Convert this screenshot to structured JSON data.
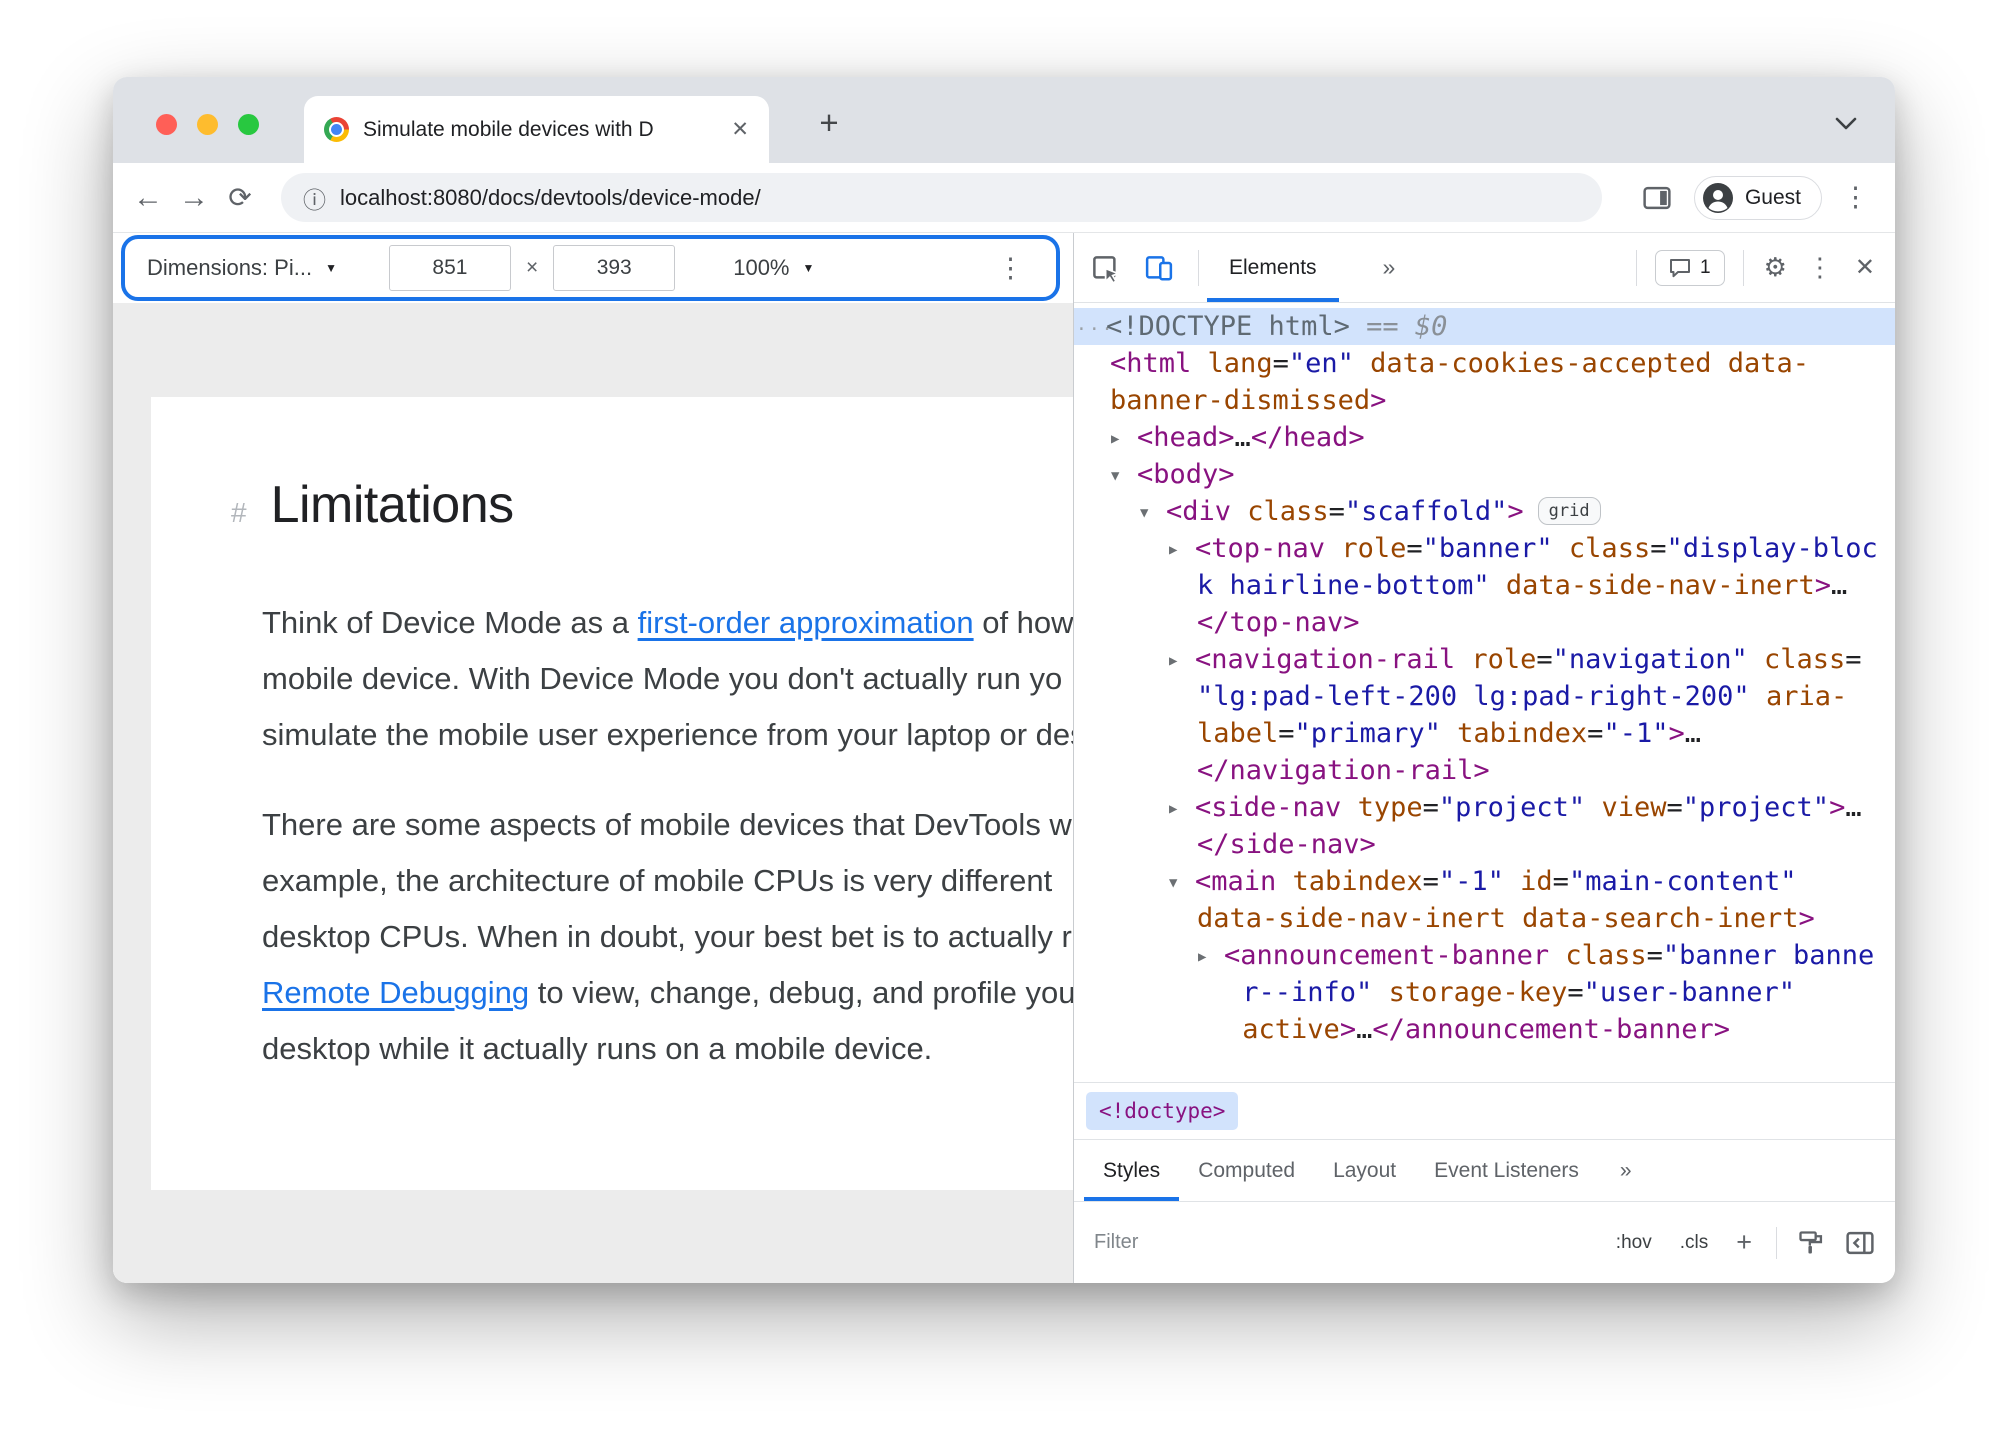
{
  "colors": {
    "accent_blue": "#1a73e8",
    "selection_blue": "#d2e3fc",
    "tag_color": "#881280",
    "attr_name_color": "#994500",
    "attr_value_color": "#1a1aa6",
    "traffic_red": "#ff5f57",
    "traffic_yellow": "#febc2e",
    "traffic_green": "#28c840"
  },
  "icons": {
    "back": "←",
    "forward": "→",
    "reload": "⟳",
    "info": "ⓘ",
    "close": "✕",
    "plus": "+",
    "kebab": "⋮",
    "caret_down": "▼",
    "multiply": "×",
    "gear": "⚙",
    "twisty_open": "▼",
    "twisty_closed": "▶",
    "dots": "···"
  },
  "browser": {
    "tab_title": "Simulate mobile devices with D",
    "url": "localhost:8080/docs/devtools/device-mode/",
    "profile_label": "Guest"
  },
  "device_toolbar": {
    "dimensions_label": "Dimensions: Pi...",
    "width": "851",
    "height": "393",
    "zoom": "100%"
  },
  "page": {
    "heading_hash": "#",
    "heading": "Limitations",
    "paragraphs": [
      {
        "lines": [
          [
            {
              "t": "Think of Device Mode as a "
            },
            {
              "t": "first-order approximation",
              "link": true
            },
            {
              "t": " of how yo"
            }
          ],
          [
            {
              "t": "mobile device. With Device Mode you don't actually run yo"
            }
          ],
          [
            {
              "t": "simulate the mobile user experience from your laptop or des"
            }
          ]
        ]
      },
      {
        "lines": [
          [
            {
              "t": "There are some aspects of mobile devices that DevTools w"
            }
          ],
          [
            {
              "t": "example, the architecture of mobile CPUs is very different"
            }
          ],
          [
            {
              "t": "desktop CPUs. When in doubt, your best bet is to actually r"
            }
          ],
          [
            {
              "t": "Remote Debugging",
              "link": true
            },
            {
              "t": " to view, change, debug, and profile your"
            }
          ],
          [
            {
              "t": "desktop while it actually runs on a mobile device."
            }
          ]
        ]
      }
    ]
  },
  "devtools": {
    "panel_tab": "Elements",
    "more": "»",
    "issues_count": "1",
    "breadcrumb": "<!doctype>",
    "styles_tabs": [
      "Styles",
      "Computed",
      "Layout",
      "Event Listeners",
      "»"
    ],
    "filter_placeholder": "Filter",
    "pseudo": ":hov",
    "classes": ".cls",
    "plus": "+",
    "tree": [
      {
        "ind": 0,
        "sel": true,
        "tok": [
          [
            "g",
            "···"
          ],
          [
            "d",
            "<!DOCTYPE html>"
          ],
          [
            "i",
            " == $0"
          ]
        ]
      },
      {
        "ind": 0,
        "tok": [
          [
            "p",
            "<html"
          ],
          [
            "t",
            " "
          ],
          [
            "a",
            "lang"
          ],
          [
            "t",
            "="
          ],
          [
            "v",
            "\"en\""
          ],
          [
            "t",
            " "
          ],
          [
            "a",
            "data-cookies-accepted"
          ],
          [
            "t",
            " "
          ],
          [
            "a",
            "data-"
          ]
        ]
      },
      {
        "ind": 0,
        "tok": [
          [
            "a",
            "banner-dismissed"
          ],
          [
            "p",
            ">"
          ]
        ]
      },
      {
        "ind": 1,
        "arrow": "closed",
        "tok": [
          [
            "p",
            "<head>"
          ],
          [
            "t",
            "…"
          ],
          [
            "p",
            "</head>"
          ]
        ]
      },
      {
        "ind": 1,
        "arrow": "open",
        "tok": [
          [
            "p",
            "<body>"
          ]
        ]
      },
      {
        "ind": 2,
        "arrow": "open",
        "tok": [
          [
            "p",
            "<div"
          ],
          [
            "t",
            " "
          ],
          [
            "a",
            "class"
          ],
          [
            "t",
            "="
          ],
          [
            "v",
            "\"scaffold\""
          ],
          [
            "p",
            ">"
          ],
          [
            "b",
            "grid"
          ]
        ]
      },
      {
        "ind": 3,
        "arrow": "closed",
        "tok": [
          [
            "p",
            "<top-nav"
          ],
          [
            "t",
            " "
          ],
          [
            "a",
            "role"
          ],
          [
            "t",
            "="
          ],
          [
            "v",
            "\"banner\""
          ],
          [
            "t",
            " "
          ],
          [
            "a",
            "class"
          ],
          [
            "t",
            "="
          ],
          [
            "v",
            "\"display-bloc"
          ]
        ]
      },
      {
        "ind": 3,
        "tok": [
          [
            "v",
            "k hairline-bottom\""
          ],
          [
            "t",
            " "
          ],
          [
            "a",
            "data-side-nav-inert"
          ],
          [
            "p",
            ">"
          ],
          [
            "t",
            "…"
          ]
        ]
      },
      {
        "ind": 3,
        "tok": [
          [
            "p",
            "</top-nav>"
          ]
        ]
      },
      {
        "ind": 3,
        "arrow": "closed",
        "tok": [
          [
            "p",
            "<navigation-rail"
          ],
          [
            "t",
            " "
          ],
          [
            "a",
            "role"
          ],
          [
            "t",
            "="
          ],
          [
            "v",
            "\"navigation\""
          ],
          [
            "t",
            " "
          ],
          [
            "a",
            "class"
          ],
          [
            "t",
            "="
          ]
        ]
      },
      {
        "ind": 3,
        "tok": [
          [
            "v",
            "\"lg:pad-left-200 lg:pad-right-200\""
          ],
          [
            "t",
            " "
          ],
          [
            "a",
            "aria-"
          ]
        ]
      },
      {
        "ind": 3,
        "tok": [
          [
            "a",
            "label"
          ],
          [
            "t",
            "="
          ],
          [
            "v",
            "\"primary\""
          ],
          [
            "t",
            " "
          ],
          [
            "a",
            "tabindex"
          ],
          [
            "t",
            "="
          ],
          [
            "v",
            "\"-1\""
          ],
          [
            "p",
            ">"
          ],
          [
            "t",
            "…"
          ]
        ]
      },
      {
        "ind": 3,
        "tok": [
          [
            "p",
            "</navigation-rail>"
          ]
        ]
      },
      {
        "ind": 3,
        "arrow": "closed",
        "tok": [
          [
            "p",
            "<side-nav"
          ],
          [
            "t",
            " "
          ],
          [
            "a",
            "type"
          ],
          [
            "t",
            "="
          ],
          [
            "v",
            "\"project\""
          ],
          [
            "t",
            " "
          ],
          [
            "a",
            "view"
          ],
          [
            "t",
            "="
          ],
          [
            "v",
            "\"project\""
          ],
          [
            "p",
            ">"
          ],
          [
            "t",
            "…"
          ]
        ]
      },
      {
        "ind": 3,
        "tok": [
          [
            "p",
            "</side-nav>"
          ]
        ]
      },
      {
        "ind": 3,
        "arrow": "open",
        "tok": [
          [
            "p",
            "<main"
          ],
          [
            "t",
            " "
          ],
          [
            "a",
            "tabindex"
          ],
          [
            "t",
            "="
          ],
          [
            "v",
            "\"-1\""
          ],
          [
            "t",
            " "
          ],
          [
            "a",
            "id"
          ],
          [
            "t",
            "="
          ],
          [
            "v",
            "\"main-content\""
          ]
        ]
      },
      {
        "ind": 3,
        "tok": [
          [
            "a",
            "data-side-nav-inert"
          ],
          [
            "t",
            " "
          ],
          [
            "a",
            "data-search-inert"
          ],
          [
            "p",
            ">"
          ]
        ]
      },
      {
        "ind": 4,
        "arrow": "closed",
        "tok": [
          [
            "p",
            "<announcement-banner"
          ],
          [
            "t",
            " "
          ],
          [
            "a",
            "class"
          ],
          [
            "t",
            "="
          ],
          [
            "v",
            "\"banner banne"
          ]
        ]
      },
      {
        "ind": 4,
        "tok": [
          [
            "t",
            " "
          ],
          [
            "v",
            "r--info\""
          ],
          [
            "t",
            " "
          ],
          [
            "a",
            "storage-key"
          ],
          [
            "t",
            "="
          ],
          [
            "v",
            "\"user-banner\""
          ]
        ]
      },
      {
        "ind": 4,
        "tok": [
          [
            "t",
            " "
          ],
          [
            "a",
            "active"
          ],
          [
            "p",
            ">"
          ],
          [
            "t",
            "…"
          ],
          [
            "p",
            "</announcement-banner>"
          ]
        ]
      }
    ]
  }
}
